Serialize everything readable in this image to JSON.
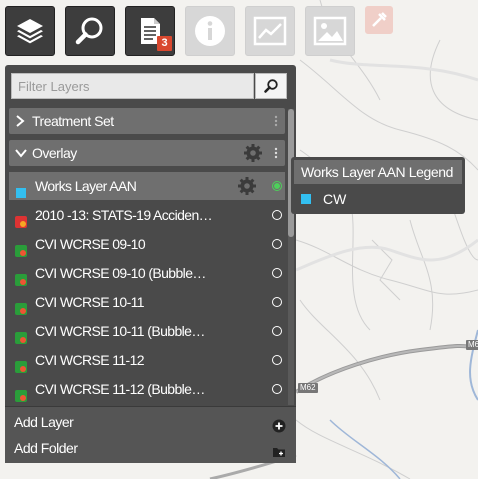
{
  "toolbar": {
    "layers_icon": "layers-icon",
    "search_icon": "search-icon",
    "document_icon": "document-icon",
    "document_badge": "3",
    "info_icon": "info-icon",
    "chart_icon": "chart-icon",
    "image_icon": "image-icon",
    "tool_icon": "tool-icon"
  },
  "filter": {
    "placeholder": "Filter Layers"
  },
  "folders": [
    {
      "label": "Treatment Set",
      "expanded": false
    },
    {
      "label": "Overlay",
      "expanded": true
    }
  ],
  "layers": [
    {
      "label": "Works Layer AAN",
      "icon": "cyan-square-icon",
      "selected": true,
      "active": true
    },
    {
      "label": "2010 -13: STATS-19 Acciden…",
      "icon": "red-point-icon",
      "selected": false,
      "active": false
    },
    {
      "label": "CVI WCRSE 09-10",
      "icon": "green-point-icon",
      "selected": false,
      "active": false
    },
    {
      "label": "CVI WCRSE 09-10 (Bubble…",
      "icon": "green-point-icon",
      "selected": false,
      "active": false
    },
    {
      "label": "CVI WCRSE 10-11",
      "icon": "green-point-icon",
      "selected": false,
      "active": false
    },
    {
      "label": "CVI WCRSE 10-11 (Bubble…",
      "icon": "green-point-icon",
      "selected": false,
      "active": false
    },
    {
      "label": "CVI WCRSE 11-12",
      "icon": "green-point-icon",
      "selected": false,
      "active": false
    },
    {
      "label": "CVI WCRSE 11-12 (Bubble…",
      "icon": "green-point-icon",
      "selected": false,
      "active": false
    }
  ],
  "footer": {
    "add_layer": "Add Layer",
    "add_folder": "Add Folder"
  },
  "legend": {
    "title": "Works Layer AAN Legend",
    "items": [
      {
        "label": "CW",
        "color": "#33bff0"
      }
    ]
  },
  "map": {
    "road_labels": [
      "M6",
      "M62"
    ]
  },
  "colors": {
    "panel": "#4a4a4a",
    "row_selected": "#6f6f6f",
    "radio_active": "#4dd05a",
    "badge": "#d9482f"
  }
}
